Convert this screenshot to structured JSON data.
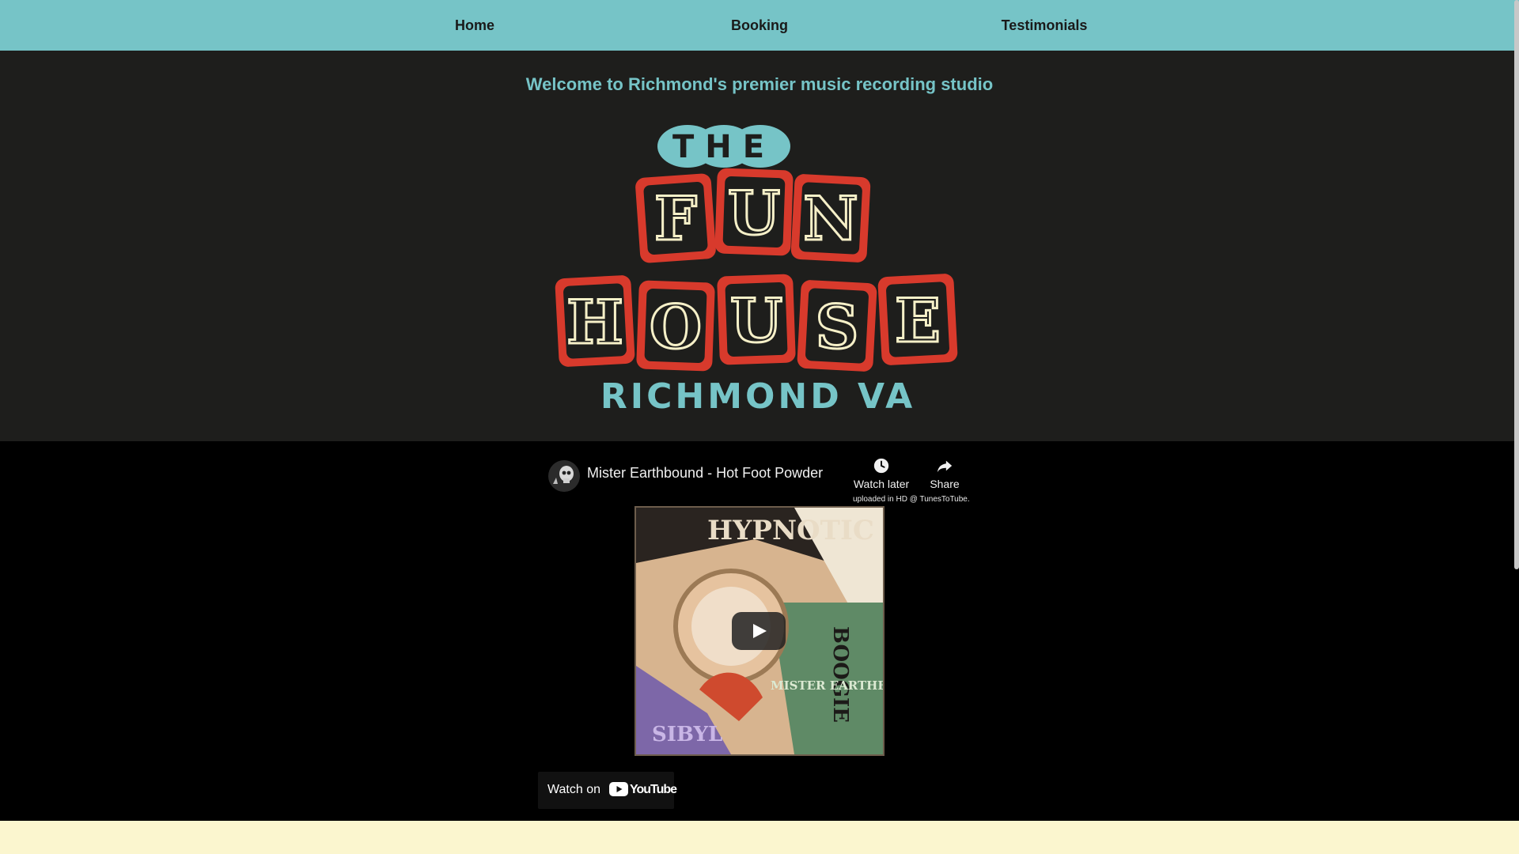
{
  "nav": {
    "items": [
      {
        "label": "Home"
      },
      {
        "label": "Booking"
      },
      {
        "label": "Testimonials"
      }
    ]
  },
  "hero": {
    "welcome_text": "Welcome to Richmond's premier music recording studio",
    "logo": {
      "the_text": "THE",
      "row1_letters": [
        "F",
        "U",
        "N"
      ],
      "row2_letters": [
        "H",
        "O",
        "U",
        "S",
        "E"
      ],
      "location_text": "RICHMOND VA"
    }
  },
  "video": {
    "title": "Mister Earthbound - Hot Foot Powder",
    "watch_later_label": "Watch later",
    "share_label": "Share",
    "uploaded_note": "uploaded in HD @ TunesToTube.",
    "watch_on_label": "Watch on",
    "youtube_wordmark": "YouTube",
    "album_art_text": [
      "HYPNOTIC",
      "BOOGIE",
      "SIBYL",
      "MISTER EARTHBOUND"
    ]
  },
  "colors": {
    "nav_bg": "#76c4c7",
    "hero_bg": "#1e1e1c",
    "accent_teal": "#76c4c7",
    "logo_red": "#d83a2c",
    "logo_cream": "#f6f0c8",
    "footer_bg": "#fbf6cf"
  }
}
